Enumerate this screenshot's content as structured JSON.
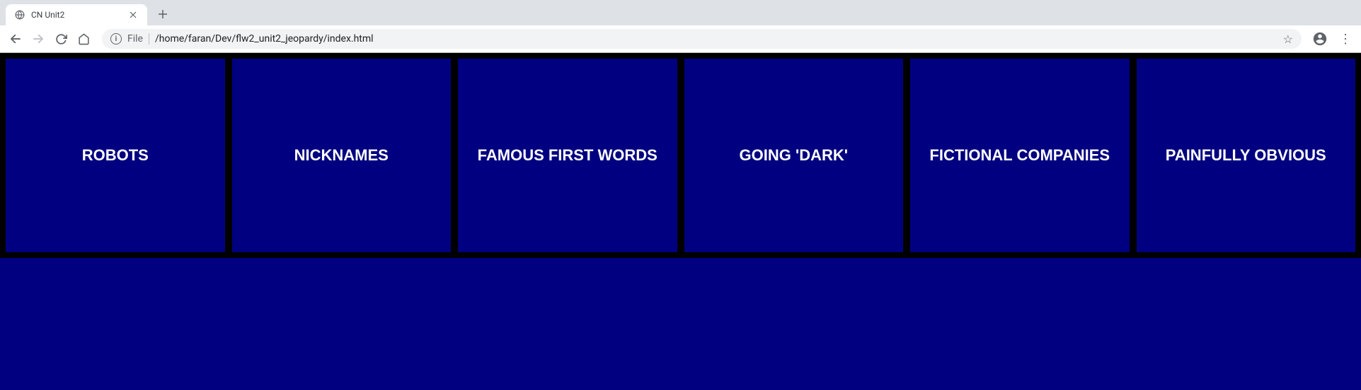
{
  "tab": {
    "title": "CN Unit2"
  },
  "address": {
    "scheme": "File",
    "path": "/home/faran/Dev/flw2_unit2_jeopardy/index.html"
  },
  "board": {
    "categories": [
      "ROBOTS",
      "NICKNAMES",
      "FAMOUS FIRST WORDS",
      "GOING 'DARK'",
      "FICTIONAL COMPANIES",
      "PAINFULLY OBVIOUS"
    ]
  }
}
